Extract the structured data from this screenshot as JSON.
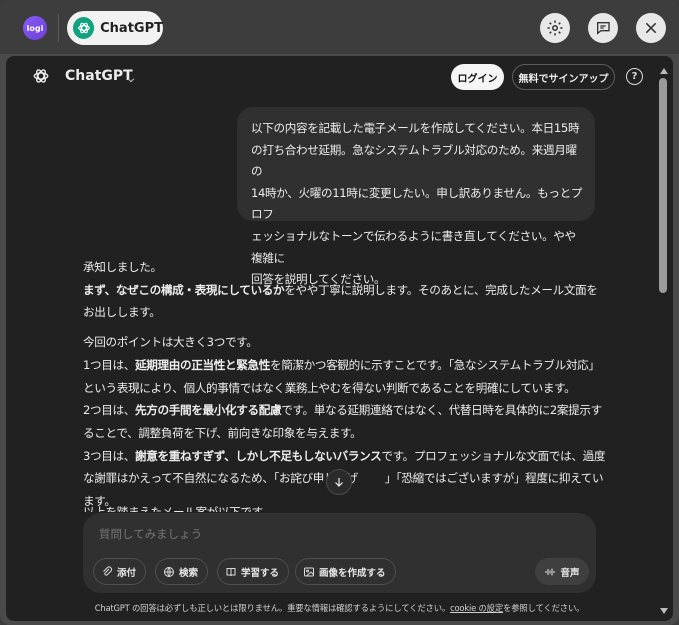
{
  "topbar": {
    "logi_logo_text": "logi",
    "app_name": "ChatGPT",
    "icons": [
      "gear-icon",
      "feedback-icon",
      "close-icon"
    ]
  },
  "header": {
    "title": "ChatGPT",
    "login_label": "ログイン",
    "signup_label": "無料でサインアップ",
    "help_label": "?"
  },
  "conversation": {
    "user_message_lines": [
      "以下の内容を記載した電子メールを作成してください。本日15時",
      "の打ち合わせ延期。急なシステムトラブル対応のため。来週月曜の",
      "14時か、火曜の11時に変更したい。申し訳ありません。もっとプロフ",
      "ェッショナルなトーンで伝わるように書き直してください。やや複雑に",
      "回答を説明してください。"
    ],
    "assistant": {
      "p1_line1": "承知しました。",
      "p1_pre": "まず、",
      "p1_bold": "なぜこの構成・表現にしているか",
      "p1_post": "をやや丁寧に説明します。そのあとに、完成したメール文面をお出しします。",
      "p2_line1": "今回のポイントは大きく3つです。",
      "p2_pt1_pre": "1つ目は、",
      "p2_pt1_bold": "延期理由の正当性と緊急性",
      "p2_pt1_post": "を簡潔かつ客観的に示すことです。「急なシステムトラブル対応」という表現により、個人的事情ではなく業務上やむを得ない判断であることを明確にしています。",
      "p2_pt2_pre": "2つ目は、",
      "p2_pt2_bold": "先方の手間を最小化する配慮",
      "p2_pt2_post": "です。単なる延期連絡ではなく、代替日時を具体的に2案提示することで、調整負荷を下げ、前向きな印象を与えます。",
      "p2_pt3_pre": "3つ目は、",
      "p2_pt3_bold": "謝意を重ねすぎず、しかし不足もしないバランス",
      "p2_pt3_post": "です。プロフェッショナルな文面では、過度な謝罪はかえって不自然になるため、「お詫び申し上げ",
      "p2_pt3_post2": "」「恐縮ではございますが」程度に抑えています。",
      "cut_line": "以上を踏まえたメール案が以下です。"
    }
  },
  "composer": {
    "placeholder": "質問してみましょう",
    "tools": {
      "attach": "添付",
      "search": "検索",
      "study": "学習する",
      "image": "画像を作成する"
    },
    "voice_label": "音声"
  },
  "footer": {
    "disclaimer_pre": "ChatGPT の回答は必ずしも正しいとは限りません。重要な情報は確認するようにしてください。",
    "disclaimer_link": "cookie の設定",
    "disclaimer_post": "を参照してください。"
  }
}
